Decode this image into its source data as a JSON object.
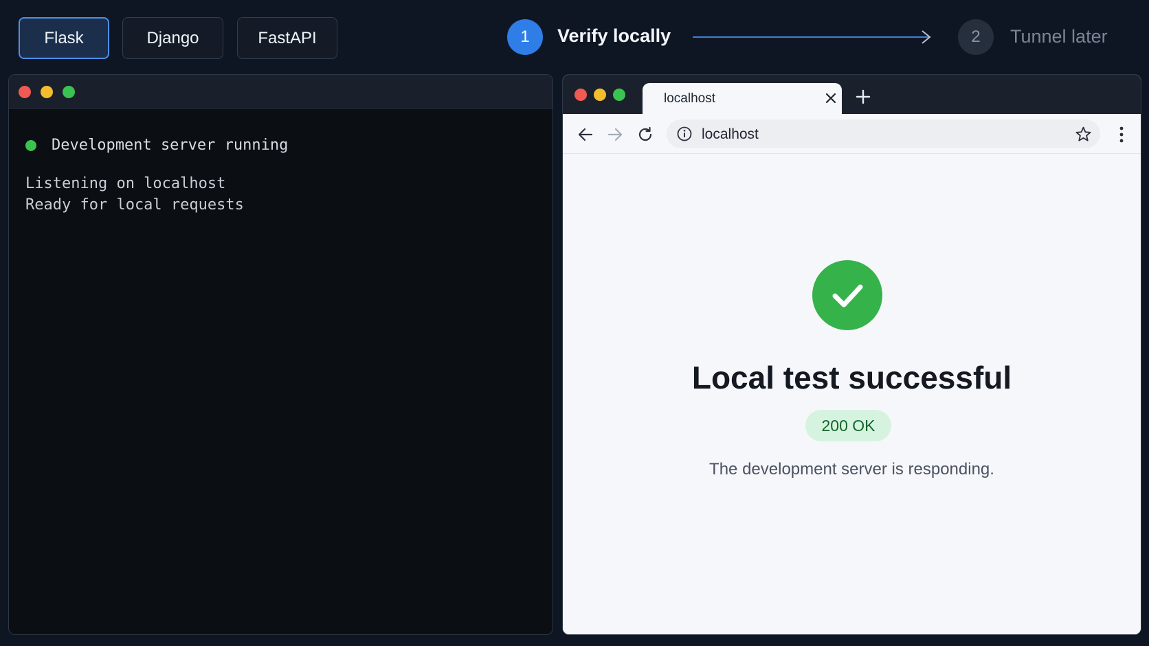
{
  "frameworks": {
    "items": [
      {
        "label": "Flask"
      },
      {
        "label": "Django"
      },
      {
        "label": "FastAPI"
      }
    ]
  },
  "stepper": {
    "step1": {
      "number": "1",
      "label": "Verify locally"
    },
    "step2": {
      "number": "2",
      "label": "Tunnel later"
    }
  },
  "terminal": {
    "status": "Development server running",
    "lines": [
      "Listening on localhost",
      "Ready for local requests"
    ]
  },
  "browser": {
    "tab_title": "localhost",
    "address": "localhost",
    "page": {
      "title": "Local test successful",
      "badge": "200 OK",
      "subtitle": "The development server is responding."
    }
  },
  "colors": {
    "accent": "#2f7ee8",
    "success": "#36b24a",
    "background": "#0f1623"
  }
}
